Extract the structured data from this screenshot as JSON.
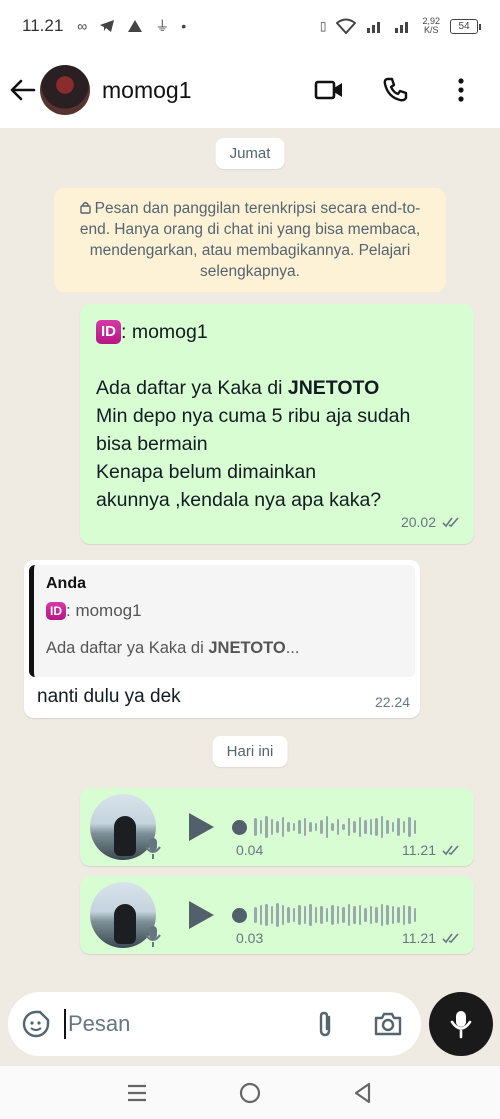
{
  "status_bar": {
    "time": "11.21",
    "speed_value": "2,92",
    "speed_unit": "K/S",
    "battery": "54"
  },
  "header": {
    "contact_name": "momog1"
  },
  "chat": {
    "day_chip_1": "Jumat",
    "encryption_notice": "Pesan dan panggilan terenkripsi secara end-to-end. Hanya orang di chat ini yang bisa membaca, mendengarkan, atau membagikannya. Pelajari selengkapnya.",
    "message_1": {
      "badge": "ID",
      "sender_line": ": momog1",
      "line_1_prefix": "Ada daftar ya Kaka di ",
      "line_1_bold": "JNETOTO",
      "line_2": "Min depo nya cuma 5 ribu aja sudah",
      "line_3": "bisa bermain",
      "line_4": "Kenapa belum dimainkan",
      "line_5": "akunnya ,kendala nya apa kaka?",
      "time": "20.02"
    },
    "message_2": {
      "quote_author": "Anda",
      "quote_badge": "ID",
      "quote_sender": ": momog1",
      "quote_preview_prefix": "Ada daftar ya Kaka di ",
      "quote_preview_bold": "JNETOTO",
      "quote_preview_suffix": "...",
      "text": "nanti dulu ya dek",
      "time": "22.24"
    },
    "day_chip_2": "Hari ini",
    "voice_notes": [
      {
        "duration": "0.04",
        "time": "11.21",
        "progress": 0
      },
      {
        "duration": "0.03",
        "time": "11.21",
        "progress": 0
      }
    ]
  },
  "input": {
    "placeholder": "Pesan"
  },
  "colors": {
    "outgoing_bubble": "#d9fdd3",
    "incoming_bubble": "#ffffff",
    "chat_bg": "#efeae2",
    "notice_bg": "#fdf1d6",
    "badge": "#c2188b"
  }
}
